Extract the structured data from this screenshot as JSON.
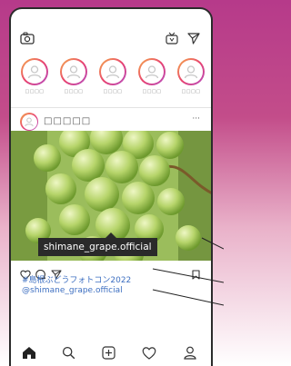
{
  "header": {
    "icons": [
      "camera-icon",
      "igtv-icon",
      "send-icon"
    ]
  },
  "stories": [
    {
      "label": "□□□□"
    },
    {
      "label": "□□□□"
    },
    {
      "label": "□□□□"
    },
    {
      "label": "□□□□"
    },
    {
      "label": "□□□□"
    }
  ],
  "post": {
    "username": "□□□□□",
    "more_label": "···",
    "photo_subject": "green-grape-bunch",
    "tag_label": "shimane_grape.official",
    "hashtag": "#島根ぶどうフォトコン2022",
    "mention": "@shimane_grape.official"
  },
  "actions": {
    "icons": [
      "heart-icon",
      "comment-icon",
      "share-icon",
      "bookmark-icon"
    ]
  },
  "tabbar": {
    "icons": [
      "home-icon",
      "search-icon",
      "new-post-icon",
      "activity-icon",
      "profile-icon"
    ]
  },
  "colors": {
    "background_top": "#b63a8a",
    "link": "#3d6fc1",
    "tag_bg": "#2a2a2a"
  }
}
